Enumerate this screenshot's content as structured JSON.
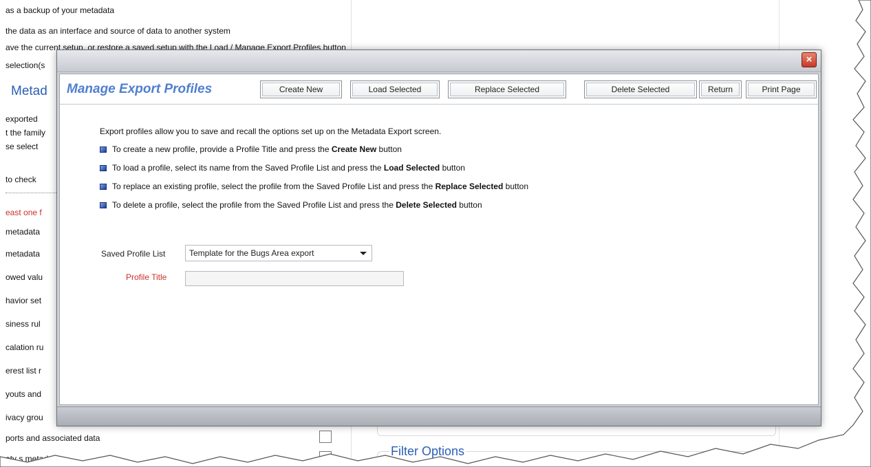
{
  "background": {
    "lines": [
      "as a backup of your metadata",
      "the data as an interface and source of data to another system",
      "ave the current setup, or restore a saved setup with the Load / Manage Export Profiles button",
      "selection(s"
    ],
    "section_heading": "Metad",
    "clipped_rows": [
      "exported",
      "t the family",
      "se select",
      "to check",
      "east one f",
      "metadata",
      "metadata",
      "owed valu",
      "havior set",
      "siness rul",
      "calation ru",
      "erest list r",
      "youts and",
      "ivacy grou",
      "ports and associated data",
      "atv    s metadata"
    ],
    "filter_heading": "Filter Options"
  },
  "modal": {
    "close_label": "×",
    "title": "Manage Export Profiles",
    "buttons": {
      "create_new": "Create New",
      "load_selected": "Load Selected",
      "replace_selected": "Replace Selected",
      "delete_selected": "Delete Selected",
      "return": "Return",
      "print_page": "Print Page"
    },
    "intro": "Export profiles allow you to save and recall the options set up on the Metadata Export screen.",
    "bullets": [
      {
        "pre": "To create a new profile, provide a Profile Title and press the ",
        "bold": "Create New",
        "post": " button"
      },
      {
        "pre": "To load a profile, select its name from the Saved Profile List and press the ",
        "bold": "Load Selected",
        "post": " button"
      },
      {
        "pre": "To replace an existing profile, select the profile from the Saved Profile List and press the ",
        "bold": "Replace Selected",
        "post": " button"
      },
      {
        "pre": "To delete a profile, select the profile from the Saved Profile List and press the ",
        "bold": "Delete Selected",
        "post": " button"
      }
    ],
    "saved_profile_label": "Saved Profile List",
    "saved_profile_value": "Template for the Bugs Area export",
    "profile_title_label": "Profile Title",
    "profile_title_value": ""
  },
  "colors": {
    "accent": "#4f7fcf",
    "required": "#c8302a",
    "close": "#c63a25"
  }
}
